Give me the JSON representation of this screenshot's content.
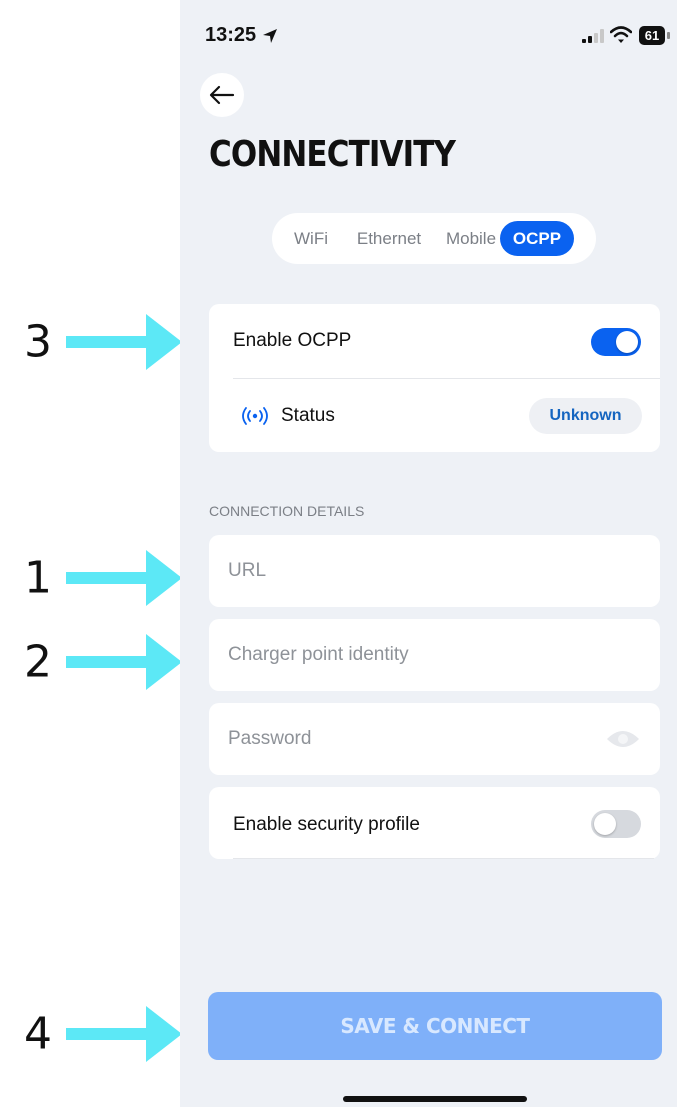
{
  "annotations": [
    {
      "number": "3"
    },
    {
      "number": "1"
    },
    {
      "number": "2"
    },
    {
      "number": "4"
    }
  ],
  "status_bar": {
    "time": "13:25",
    "battery": "61"
  },
  "header": {
    "title": "CONNECTIVITY"
  },
  "tabs": [
    {
      "label": "WiFi",
      "active": false
    },
    {
      "label": "Ethernet",
      "active": false
    },
    {
      "label": "Mobile",
      "active": false
    },
    {
      "label": "OCPP",
      "active": true
    }
  ],
  "ocpp": {
    "enable_label": "Enable OCPP",
    "enabled": true,
    "status_label": "Status",
    "status_value": "Unknown"
  },
  "connection_details": {
    "section_label": "CONNECTION DETAILS",
    "url_placeholder": "URL",
    "identity_placeholder": "Charger point identity",
    "password_placeholder": "Password",
    "security_label": "Enable security profile",
    "security_enabled": false
  },
  "actions": {
    "save_label": "SAVE & CONNECT"
  },
  "colors": {
    "accent": "#0a62f0",
    "arrow": "#5ce8f6",
    "background": "#eef1f6",
    "button_disabled": "#7fb0f9"
  }
}
